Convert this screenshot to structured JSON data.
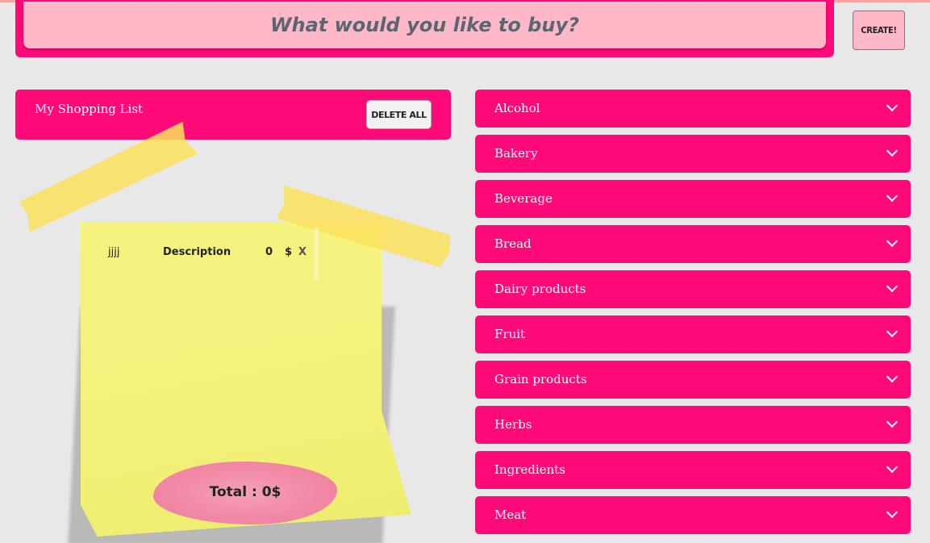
{
  "search": {
    "placeholder": "What would you like to buy?"
  },
  "create_label": "CREATE!",
  "list": {
    "title": "My Shopping List",
    "delete_all_label": "DELETE ALL",
    "items": [
      {
        "name": "jjjj",
        "description": "Description",
        "price": "0",
        "currency": "$",
        "remove": "X"
      }
    ],
    "total": "Total : 0$"
  },
  "categories": [
    "Alcohol",
    "Bakery",
    "Beverage",
    "Bread",
    "Dairy products",
    "Fruit",
    "Grain products",
    "Herbs",
    "Ingredients",
    "Meat"
  ],
  "colors": {
    "primary": "#ff0a78",
    "input_bg": "#ffb8c8",
    "note": "#f4f27a",
    "background": "#e9e8e8"
  }
}
